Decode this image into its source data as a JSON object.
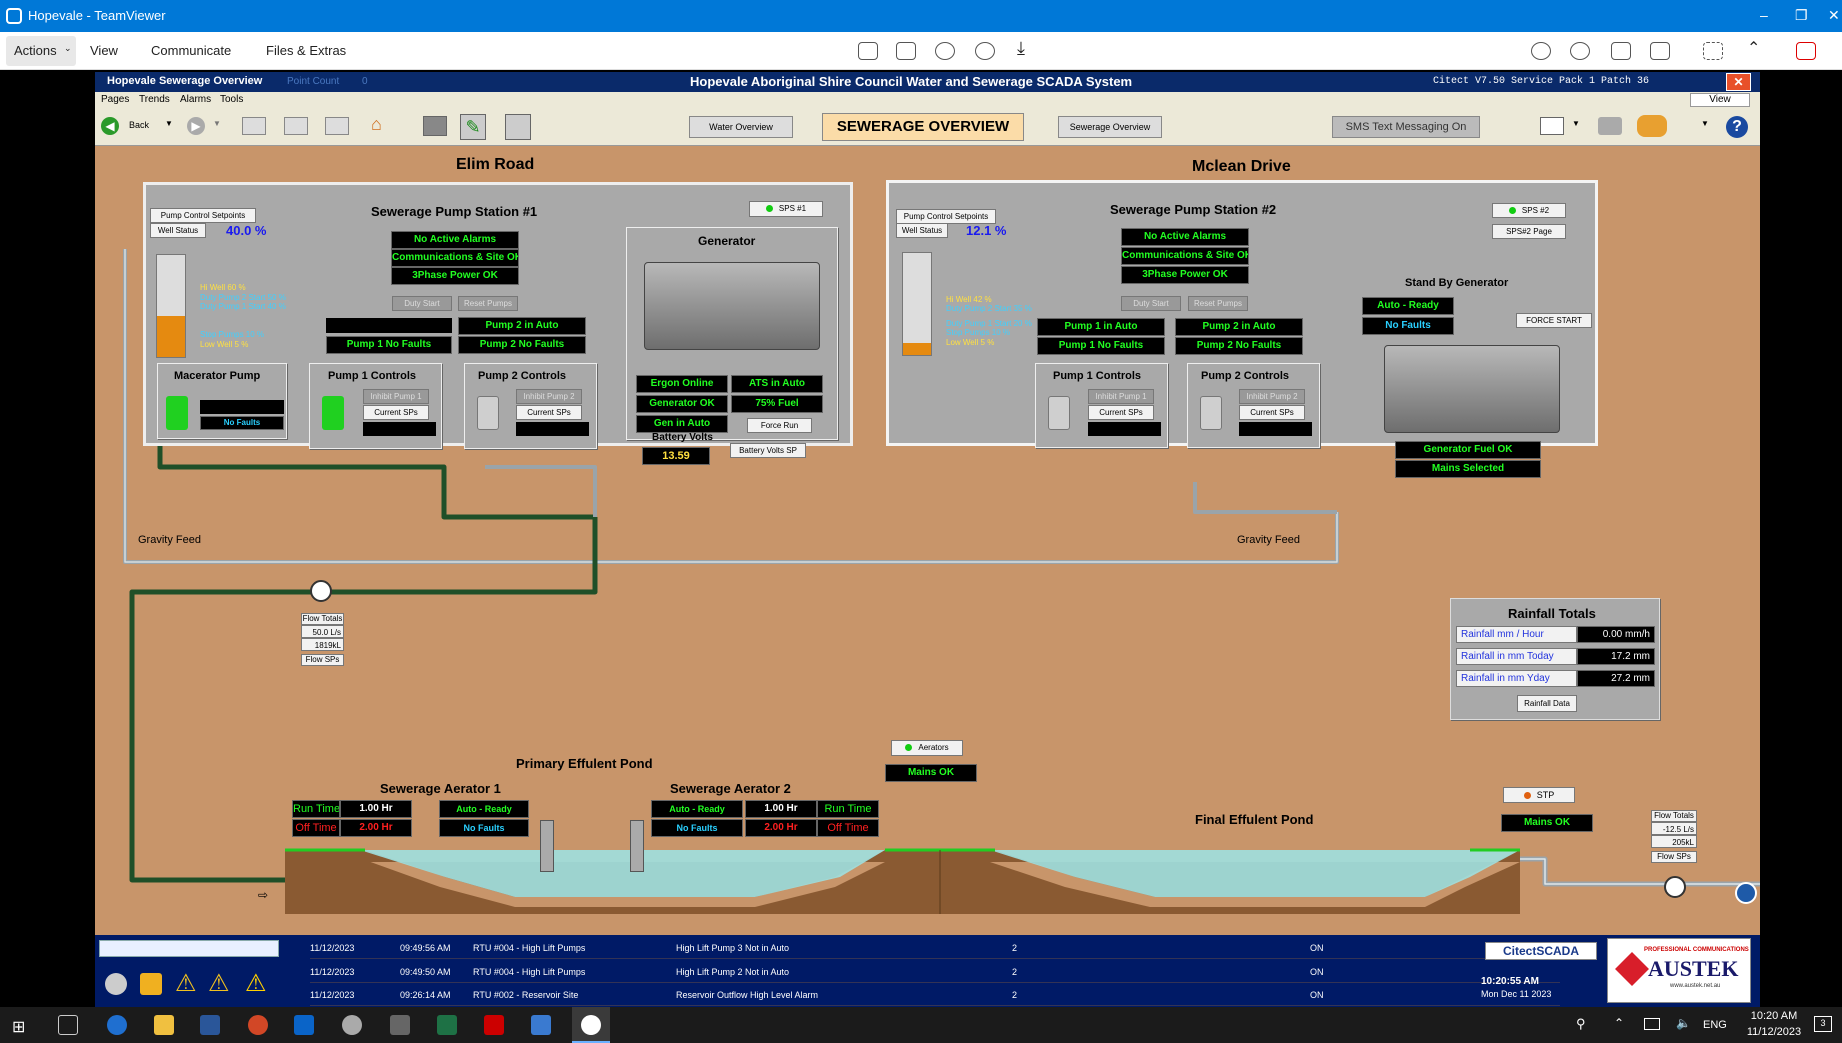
{
  "window": {
    "title": "Hopevale - TeamViewer"
  },
  "tv_menu": {
    "actions": "Actions",
    "view": "View",
    "communicate": "Communicate",
    "files": "Files & Extras"
  },
  "scada": {
    "page_label": "Hopevale Sewerage Overview",
    "point_count_label": "Point Count",
    "point_count": "0",
    "system_title": "Hopevale Aboriginal Shire Council Water and Sewerage SCADA System",
    "version": "Citect V7.50 Service Pack 1 Patch 36",
    "menus": [
      "Pages",
      "Trends",
      "Alarms",
      "Tools"
    ],
    "view_label": "View",
    "back_label": "Back",
    "water_overview": "Water Overview",
    "page_heading": "SEWERAGE OVERVIEW",
    "sewerage_overview": "Sewerage Overview",
    "sms": "SMS Text Messaging On"
  },
  "sps1": {
    "site": "Elim Road",
    "title": "Sewerage Pump Station #1",
    "nav": "SPS #1",
    "setpoints": "Pump Control Setpoints",
    "well_status": "Well Status",
    "level": "40.0 %",
    "level_fill": 0.4,
    "well_levels": [
      "Hi Well 60 %",
      "Duty Pump 2 Start 50 %",
      "Duty Pump 1 Start 40 %",
      "Stop Pumps 10 %",
      "Low Well 5 %"
    ],
    "status": [
      "No Active Alarms",
      "Communications & Site OK",
      "3Phase Power OK"
    ],
    "duty_start": "Duty Start",
    "reset_pumps": "Reset Pumps",
    "pump2_auto": "Pump 2 in Auto",
    "pump1_faults": "Pump 1 No Faults",
    "pump2_faults": "Pump 2 No Faults",
    "macerator": "Macerator Pump",
    "macerator_faults": "No Faults",
    "pump1_controls": "Pump 1 Controls",
    "pump2_controls": "Pump 2 Controls",
    "inhibit1": "Inhibit Pump 1",
    "inhibit2": "Inhibit Pump 2",
    "current_sps": "Current SPs",
    "generator": "Generator",
    "ergon": "Ergon Online",
    "ats": "ATS in Auto",
    "gen_ok": "Generator OK",
    "fuel": "75% Fuel",
    "gen_auto": "Gen in Auto",
    "force_run": "Force Run",
    "battery_label": "Battery Volts",
    "battery": "13.59",
    "battery_sp": "Battery Volts SP",
    "gravity": "Gravity Feed"
  },
  "sps2": {
    "site": "Mclean Drive",
    "title": "Sewerage Pump Station #2",
    "nav": "SPS #2",
    "page": "SPS#2 Page",
    "setpoints": "Pump Control Setpoints",
    "well_status": "Well Status",
    "level": "12.1 %",
    "level_fill": 0.121,
    "well_levels": [
      "Hi Well 42 %",
      "Duty Pump 2 Start 35 %",
      "Duty Pump 1 Start 20 %",
      "Stop Pumps 10 %",
      "Low Well 5 %"
    ],
    "status": [
      "No Active Alarms",
      "Communications & Site OK",
      "3Phase Power OK"
    ],
    "duty_start": "Duty Start",
    "reset_pumps": "Reset Pumps",
    "pump1_auto": "Pump 1 in Auto",
    "pump2_auto": "Pump 2 in Auto",
    "pump1_faults": "Pump 1 No Faults",
    "pump2_faults": "Pump 2 No Faults",
    "pump1_controls": "Pump 1 Controls",
    "pump2_controls": "Pump 2 Controls",
    "inhibit1": "Inhibit Pump 1",
    "inhibit2": "Inhibit Pump 2",
    "current_sps": "Current SPs",
    "standby": "Stand By Generator",
    "auto_ready": "Auto - Ready",
    "no_faults": "No Faults",
    "force_start": "FORCE START",
    "fuel_ok": "Generator Fuel OK",
    "mains": "Mains Selected",
    "gravity": "Gravity Feed"
  },
  "flow1": {
    "label": "Flow Totals",
    "rate": "50.0 L/s",
    "total": "1819kL",
    "sps": "Flow SPs"
  },
  "flow2": {
    "label": "Flow Totals",
    "rate": "-12.5 L/s",
    "total": "205kL",
    "sps": "Flow SPs"
  },
  "rainfall": {
    "title": "Rainfall Totals",
    "rows": [
      {
        "label": "Rainfall mm / Hour",
        "value": "0.00 mm/h"
      },
      {
        "label": "Rainfall in mm Today",
        "value": "17.2 mm"
      },
      {
        "label": "Rainfall in mm Yday",
        "value": "27.2 mm"
      }
    ],
    "button": "Rainfall Data"
  },
  "ponds": {
    "primary": "Primary Effulent Pond",
    "final": "Final Effulent Pond",
    "aerator1": {
      "title": "Sewerage Aerator 1",
      "run_label": "Run Time",
      "run": "1.00 Hr",
      "off_label": "Off Time",
      "off": "2.00 Hr",
      "state": "Auto - Ready",
      "faults": "No Faults"
    },
    "aerator2": {
      "title": "Sewerage Aerator 2",
      "run_label": "Run Time",
      "run": "1.00 Hr",
      "off_label": "Off Time",
      "off": "2.00 Hr",
      "state": "Auto - Ready",
      "faults": "No Faults"
    },
    "aerators": "Aerators",
    "aerators_mains": "Mains OK",
    "stp": "STP",
    "stp_mains": "Mains OK"
  },
  "alarms": [
    {
      "date": "11/12/2023",
      "time": "09:49:56 AM",
      "rtu": "RTU #004 - High Lift Pumps",
      "desc": "High Lift Pump 3 Not in Auto",
      "n": "2",
      "state": "ON"
    },
    {
      "date": "11/12/2023",
      "time": "09:49:50 AM",
      "rtu": "RTU #004 - High Lift Pumps",
      "desc": "High Lift Pump 2 Not in Auto",
      "n": "2",
      "state": "ON"
    },
    {
      "date": "11/12/2023",
      "time": "09:26:14 AM",
      "rtu": "RTU #002 - Reservoir Site",
      "desc": "Reservoir Outflow High Level Alarm",
      "n": "2",
      "state": "ON"
    }
  ],
  "footer": {
    "citect": "CitectSCADA",
    "time": "10:20:55 AM",
    "date": "Mon Dec 11 2023",
    "brand": "AUSTEK",
    "brand_sub": "PROFESSIONAL COMMUNICATIONS",
    "brand_url": "www.austek.net.au"
  },
  "taskbar": {
    "lang": "ENG",
    "time": "10:20 AM",
    "date": "11/12/2023",
    "notif": "3"
  }
}
